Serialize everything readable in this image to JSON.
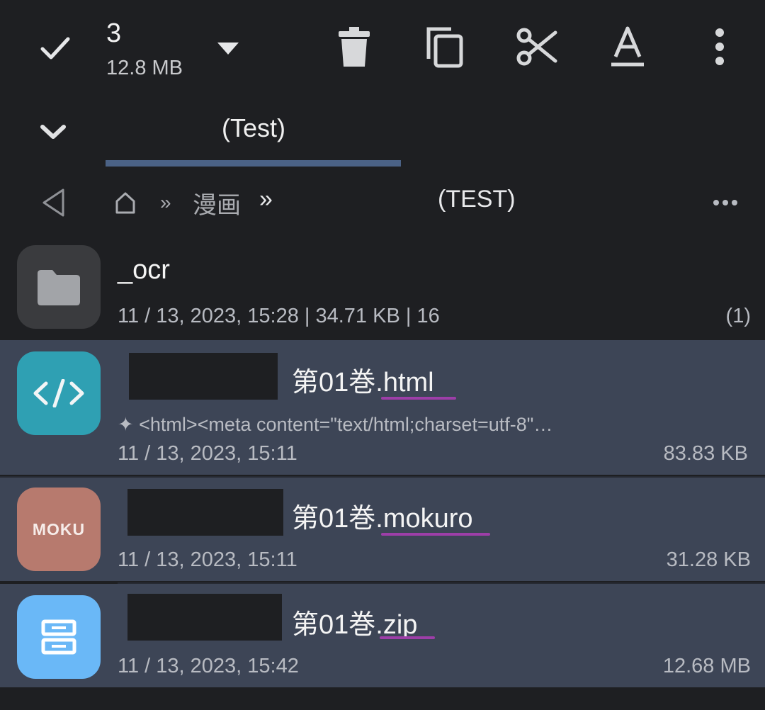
{
  "selection": {
    "count": "3",
    "size": "12.8 MB"
  },
  "tab": {
    "label": "(Test)"
  },
  "breadcrumb": {
    "sep1": "»",
    "folder": "漫画",
    "sep2": "»",
    "current": "(TEST)"
  },
  "files": [
    {
      "name": "_ocr",
      "meta": "11 / 13, 2023, 15:28 | 34.71  KB | 16",
      "extra": "(1)",
      "icon": "folder-icon"
    },
    {
      "name_base": "第01巻",
      "name_ext": ".html",
      "preview": "✦ <html><meta content=\"text/html;charset=utf-8\"…",
      "date": "11 / 13, 2023, 15:11",
      "size": "83.83  KB",
      "icon": "html-file-icon"
    },
    {
      "name_base": "第01巻",
      "name_ext": ".mokuro",
      "tile_text": "MOKU",
      "date": "11 / 13, 2023, 15:11",
      "size": "31.28  KB",
      "icon": "mokuro-file-icon"
    },
    {
      "name_base": "第01巻",
      "name_ext": ".zip",
      "date": "11 / 13, 2023, 15:42",
      "size": "12.68 MB",
      "icon": "zip-archive-icon"
    }
  ],
  "colors": {
    "background": "#1e1f22",
    "selected_row": "#3d4556",
    "tab_accent": "#4b6286",
    "ext_underline": "#9d3ea8",
    "html_tile": "#2fa0b3",
    "mokuro_tile": "#b77a6e",
    "zip_tile": "#6ab8f7"
  }
}
